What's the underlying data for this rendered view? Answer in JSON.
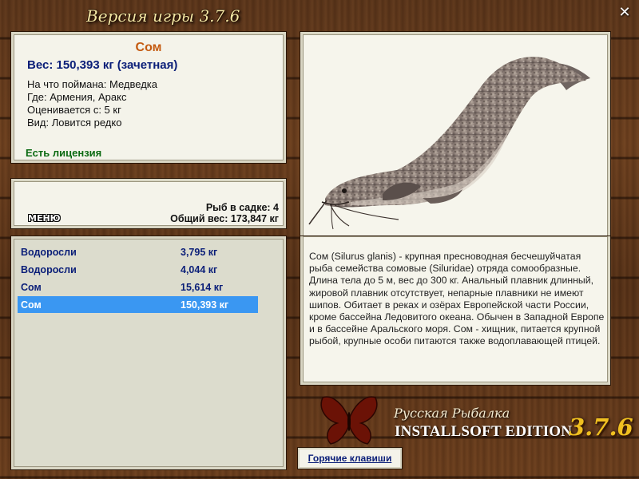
{
  "window": {
    "title": "Версия игры 3.7.6",
    "close_icon": "close-icon"
  },
  "fish_info": {
    "name": "Сом",
    "weight_line": "Вес: 150,393 кг (зачетная)",
    "bait_line": "На что поймана: Медведка",
    "location_line": "Где: Армения, Аракс",
    "rated_from_line": "Оценивается с: 5 кг",
    "rarity_line": "Вид: Ловится редко",
    "license": "Есть лицензия"
  },
  "stats": {
    "fish_in_keepnet": "Рыб в садке: 4",
    "total_weight": "Общий вес: 173,847 кг",
    "menu_label": "МЕНЮ"
  },
  "catch_list": [
    {
      "name": "Водоросли",
      "weight": "3,795 кг",
      "selected": false
    },
    {
      "name": "Водоросли",
      "weight": "4,044 кг",
      "selected": false
    },
    {
      "name": "Сом",
      "weight": "15,614 кг",
      "selected": false
    },
    {
      "name": "Сом",
      "weight": "150,393 кг",
      "selected": true
    }
  ],
  "description": "Сом (Silurus glanis) - крупная пресноводная бесчешуйчатая рыба семейства сомовые (Siluridae) отряда сомообразные. Длина тела до 5 м, вес до 300 кг. Анальный плавник длинный, жировой плавник отсутствует, непарные плавники не имеют шипов. Обитает в реках и озёрах Европейской части России, кроме бассейна Ледовитого океана. Обычен в Западной Европе и в бассейне Аральского моря. Сом - хищник, питается крупной рыбой, крупные особи питаются также водоплавающей птицей.",
  "branding": {
    "line1": "Русская Рыбалка",
    "line2": "INSTALLSOFT EDITION",
    "version": "3.7.6"
  },
  "hotkeys_label": "Горячие клавиши",
  "colors": {
    "fish_name": "#c45a10",
    "weight_text": "#0a1e78",
    "license_text": "#0b6a12",
    "selected_row": "#3a97f2",
    "version_gold": "#f0c020"
  }
}
